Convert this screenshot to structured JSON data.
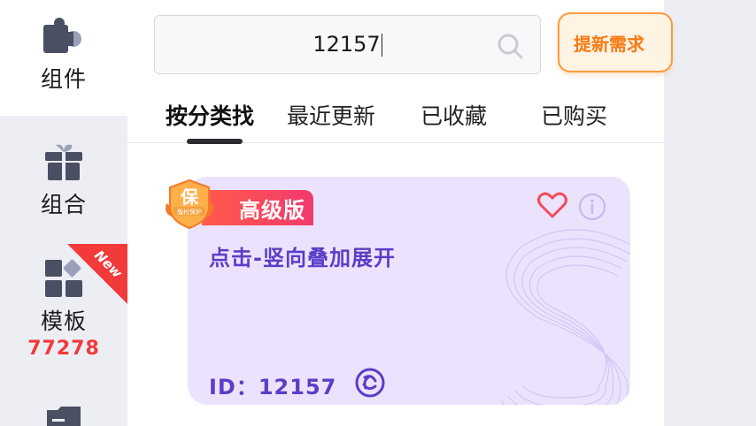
{
  "rail": {
    "items": [
      {
        "label": "组件"
      },
      {
        "label": "组合"
      },
      {
        "label": "模板",
        "count": "77278",
        "ribbon": "New"
      },
      {
        "label": ""
      }
    ]
  },
  "search": {
    "value": "12157"
  },
  "header": {
    "request_button": "提新需求"
  },
  "tabs": [
    {
      "label": "按分类找",
      "active": true
    },
    {
      "label": "最近更新"
    },
    {
      "label": "已收藏"
    },
    {
      "label": "已购买"
    }
  ],
  "card": {
    "level": "高级版",
    "title": "点击-竖向叠加展开",
    "id_text": "ID：12157",
    "guard_text": "保",
    "guard_sub": "版权保护"
  },
  "colors": {
    "accent": "#5b3ec7",
    "card_bg": "#ebe3fd",
    "badge": "#f23a6e",
    "request_btn": "#f77a13",
    "new_ribbon": "#f23a3a"
  }
}
